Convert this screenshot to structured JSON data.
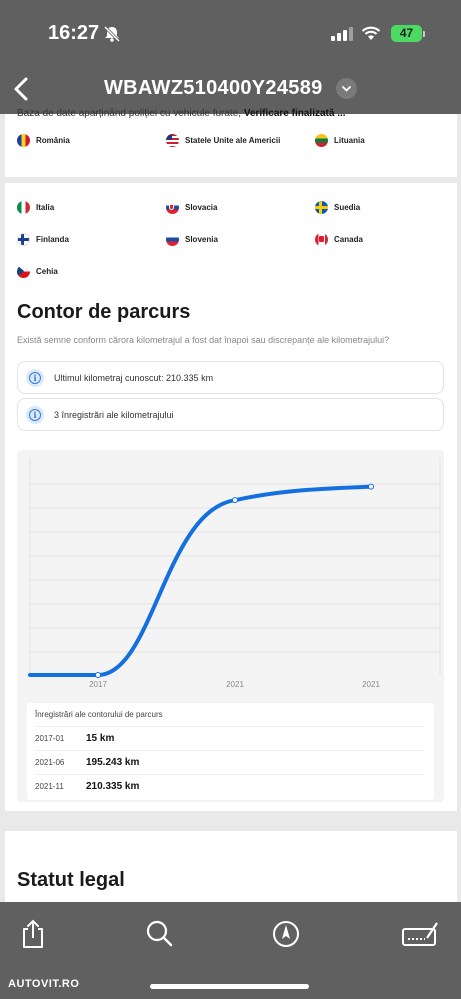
{
  "status_bar": {
    "time": "16:27",
    "battery": "47"
  },
  "nav": {
    "title": "WBAWZ510400Y24589"
  },
  "top_card": {
    "partial_text": "Baza de date aparținând poliției cu vehicule furate,",
    "partial_bold": "Verificare finalizată ...",
    "countries": [
      "România",
      "Statele Unite ale Americii",
      "Lituania"
    ]
  },
  "countries": [
    "Italia",
    "Slovacia",
    "Suedia",
    "Finlanda",
    "Slovenia",
    "Canada",
    "Cehia"
  ],
  "odometer": {
    "title": "Contor de parcurs",
    "subtitle": "Există semne conform cărora kilometrajul a fost dat înapoi sau discrepanțe ale kilometrajului?",
    "last_known": "Ultimul kilometraj cunoscut: 210.335 km",
    "records_count": "3 înregistrări ale kilometrajului"
  },
  "chart_data": {
    "type": "line",
    "x": [
      "2017-01",
      "2021-06",
      "2021-11"
    ],
    "y": [
      15,
      195243,
      210335
    ],
    "tick_labels": [
      "2017",
      "2021",
      "2021"
    ],
    "grid": true,
    "color": "#1470e0"
  },
  "records": {
    "title": "Înregistrări ale contorului de parcurs",
    "rows": [
      {
        "date": "2017-01",
        "km": "15 km"
      },
      {
        "date": "2021-06",
        "km": "195.243 km"
      },
      {
        "date": "2021-11",
        "km": "210.335 km"
      }
    ]
  },
  "legal": {
    "title": "Statut legal"
  },
  "watermark": "AUTOVIT.RO",
  "icons": [
    "share-icon",
    "search-icon",
    "compass-icon",
    "edit-icon"
  ]
}
